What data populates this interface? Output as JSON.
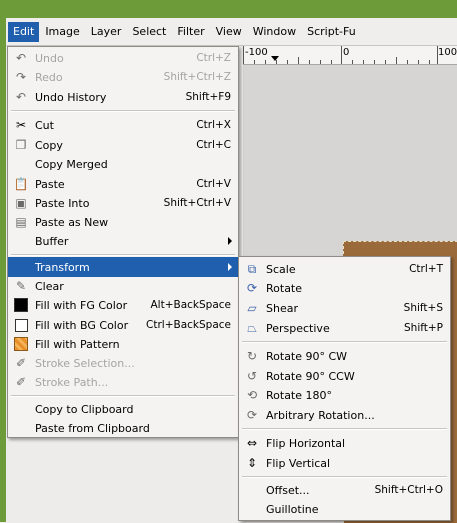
{
  "menubar": {
    "items": [
      "Edit",
      "Image",
      "Layer",
      "Select",
      "Filter",
      "View",
      "Window",
      "Script-Fu"
    ],
    "active": "Edit"
  },
  "ruler": {
    "labels": [
      "-100",
      "0",
      "100"
    ]
  },
  "edit_menu": {
    "items": [
      {
        "label": "Undo",
        "shortcut": "Ctrl+Z",
        "icon": "undo-icon",
        "disabled": true
      },
      {
        "label": "Redo",
        "shortcut": "Shift+Ctrl+Z",
        "icon": "redo-icon",
        "disabled": true
      },
      {
        "label": "Undo History",
        "shortcut": "Shift+F9",
        "icon": "undo-history-icon"
      },
      {
        "label": "Cut",
        "shortcut": "Ctrl+X",
        "icon": "scissors-icon"
      },
      {
        "label": "Copy",
        "shortcut": "Ctrl+C",
        "icon": "copy-icon"
      },
      {
        "label": "Copy Merged",
        "shortcut": ""
      },
      {
        "label": "Paste",
        "shortcut": "Ctrl+V",
        "icon": "paste-icon"
      },
      {
        "label": "Paste Into",
        "shortcut": "Shift+Ctrl+V",
        "icon": "paste-into-icon"
      },
      {
        "label": "Paste as New",
        "shortcut": "",
        "icon": "paste-new-icon"
      },
      {
        "label": "Buffer",
        "shortcut": "",
        "submenu": true
      },
      {
        "label": "Transform",
        "shortcut": "",
        "submenu": true,
        "highlighted": true
      },
      {
        "label": "Clear",
        "shortcut": "",
        "icon": "eraser-icon"
      },
      {
        "label": "Fill with FG Color",
        "shortcut": "Alt+BackSpace",
        "icon": "fg-color-swatch-icon"
      },
      {
        "label": "Fill with BG Color",
        "shortcut": "Ctrl+BackSpace",
        "icon": "bg-color-swatch-icon"
      },
      {
        "label": "Fill with Pattern",
        "shortcut": "",
        "icon": "pattern-swatch-icon"
      },
      {
        "label": "Stroke Selection...",
        "shortcut": "",
        "icon": "stroke-selection-icon",
        "disabled": true
      },
      {
        "label": "Stroke Path...",
        "shortcut": "",
        "icon": "stroke-path-icon",
        "disabled": true
      },
      {
        "label": "Copy to Clipboard",
        "shortcut": ""
      },
      {
        "label": "Paste from Clipboard",
        "shortcut": ""
      }
    ]
  },
  "transform_menu": {
    "items": [
      {
        "label": "Scale",
        "shortcut": "Ctrl+T",
        "icon": "scale-icon"
      },
      {
        "label": "Rotate",
        "shortcut": "",
        "icon": "rotate-icon"
      },
      {
        "label": "Shear",
        "shortcut": "Shift+S",
        "icon": "shear-icon"
      },
      {
        "label": "Perspective",
        "shortcut": "Shift+P",
        "icon": "perspective-icon"
      },
      {
        "label": "Rotate 90° CW",
        "shortcut": "",
        "icon": "rotate-cw-icon"
      },
      {
        "label": "Rotate 90° CCW",
        "shortcut": "",
        "icon": "rotate-ccw-icon"
      },
      {
        "label": "Rotate 180°",
        "shortcut": "",
        "icon": "rotate-180-icon"
      },
      {
        "label": "Arbitrary Rotation...",
        "shortcut": "",
        "icon": "arbitrary-rotation-icon"
      },
      {
        "label": "Flip Horizontal",
        "shortcut": "",
        "icon": "flip-horizontal-icon"
      },
      {
        "label": "Flip Vertical",
        "shortcut": "",
        "icon": "flip-vertical-icon"
      },
      {
        "label": "Offset...",
        "shortcut": "Shift+Ctrl+O"
      },
      {
        "label": "Guillotine",
        "shortcut": ""
      }
    ]
  }
}
